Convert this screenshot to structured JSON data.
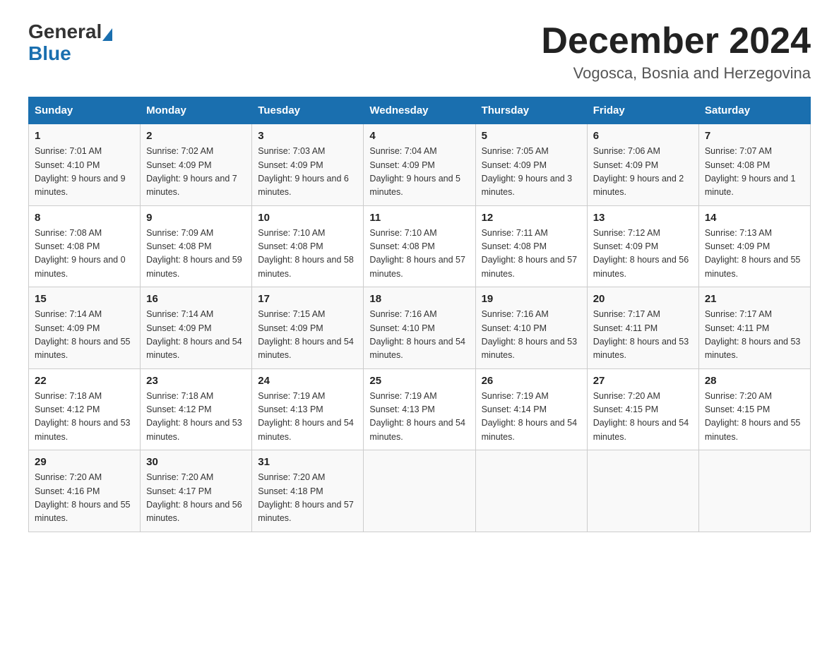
{
  "header": {
    "month_title": "December 2024",
    "location": "Vogosca, Bosnia and Herzegovina",
    "logo_general": "General",
    "logo_blue": "Blue"
  },
  "columns": [
    "Sunday",
    "Monday",
    "Tuesday",
    "Wednesday",
    "Thursday",
    "Friday",
    "Saturday"
  ],
  "weeks": [
    [
      {
        "day": "1",
        "sunrise": "7:01 AM",
        "sunset": "4:10 PM",
        "daylight": "9 hours and 9 minutes."
      },
      {
        "day": "2",
        "sunrise": "7:02 AM",
        "sunset": "4:09 PM",
        "daylight": "9 hours and 7 minutes."
      },
      {
        "day": "3",
        "sunrise": "7:03 AM",
        "sunset": "4:09 PM",
        "daylight": "9 hours and 6 minutes."
      },
      {
        "day": "4",
        "sunrise": "7:04 AM",
        "sunset": "4:09 PM",
        "daylight": "9 hours and 5 minutes."
      },
      {
        "day": "5",
        "sunrise": "7:05 AM",
        "sunset": "4:09 PM",
        "daylight": "9 hours and 3 minutes."
      },
      {
        "day": "6",
        "sunrise": "7:06 AM",
        "sunset": "4:09 PM",
        "daylight": "9 hours and 2 minutes."
      },
      {
        "day": "7",
        "sunrise": "7:07 AM",
        "sunset": "4:08 PM",
        "daylight": "9 hours and 1 minute."
      }
    ],
    [
      {
        "day": "8",
        "sunrise": "7:08 AM",
        "sunset": "4:08 PM",
        "daylight": "9 hours and 0 minutes."
      },
      {
        "day": "9",
        "sunrise": "7:09 AM",
        "sunset": "4:08 PM",
        "daylight": "8 hours and 59 minutes."
      },
      {
        "day": "10",
        "sunrise": "7:10 AM",
        "sunset": "4:08 PM",
        "daylight": "8 hours and 58 minutes."
      },
      {
        "day": "11",
        "sunrise": "7:10 AM",
        "sunset": "4:08 PM",
        "daylight": "8 hours and 57 minutes."
      },
      {
        "day": "12",
        "sunrise": "7:11 AM",
        "sunset": "4:08 PM",
        "daylight": "8 hours and 57 minutes."
      },
      {
        "day": "13",
        "sunrise": "7:12 AM",
        "sunset": "4:09 PM",
        "daylight": "8 hours and 56 minutes."
      },
      {
        "day": "14",
        "sunrise": "7:13 AM",
        "sunset": "4:09 PM",
        "daylight": "8 hours and 55 minutes."
      }
    ],
    [
      {
        "day": "15",
        "sunrise": "7:14 AM",
        "sunset": "4:09 PM",
        "daylight": "8 hours and 55 minutes."
      },
      {
        "day": "16",
        "sunrise": "7:14 AM",
        "sunset": "4:09 PM",
        "daylight": "8 hours and 54 minutes."
      },
      {
        "day": "17",
        "sunrise": "7:15 AM",
        "sunset": "4:09 PM",
        "daylight": "8 hours and 54 minutes."
      },
      {
        "day": "18",
        "sunrise": "7:16 AM",
        "sunset": "4:10 PM",
        "daylight": "8 hours and 54 minutes."
      },
      {
        "day": "19",
        "sunrise": "7:16 AM",
        "sunset": "4:10 PM",
        "daylight": "8 hours and 53 minutes."
      },
      {
        "day": "20",
        "sunrise": "7:17 AM",
        "sunset": "4:11 PM",
        "daylight": "8 hours and 53 minutes."
      },
      {
        "day": "21",
        "sunrise": "7:17 AM",
        "sunset": "4:11 PM",
        "daylight": "8 hours and 53 minutes."
      }
    ],
    [
      {
        "day": "22",
        "sunrise": "7:18 AM",
        "sunset": "4:12 PM",
        "daylight": "8 hours and 53 minutes."
      },
      {
        "day": "23",
        "sunrise": "7:18 AM",
        "sunset": "4:12 PM",
        "daylight": "8 hours and 53 minutes."
      },
      {
        "day": "24",
        "sunrise": "7:19 AM",
        "sunset": "4:13 PM",
        "daylight": "8 hours and 54 minutes."
      },
      {
        "day": "25",
        "sunrise": "7:19 AM",
        "sunset": "4:13 PM",
        "daylight": "8 hours and 54 minutes."
      },
      {
        "day": "26",
        "sunrise": "7:19 AM",
        "sunset": "4:14 PM",
        "daylight": "8 hours and 54 minutes."
      },
      {
        "day": "27",
        "sunrise": "7:20 AM",
        "sunset": "4:15 PM",
        "daylight": "8 hours and 54 minutes."
      },
      {
        "day": "28",
        "sunrise": "7:20 AM",
        "sunset": "4:15 PM",
        "daylight": "8 hours and 55 minutes."
      }
    ],
    [
      {
        "day": "29",
        "sunrise": "7:20 AM",
        "sunset": "4:16 PM",
        "daylight": "8 hours and 55 minutes."
      },
      {
        "day": "30",
        "sunrise": "7:20 AM",
        "sunset": "4:17 PM",
        "daylight": "8 hours and 56 minutes."
      },
      {
        "day": "31",
        "sunrise": "7:20 AM",
        "sunset": "4:18 PM",
        "daylight": "8 hours and 57 minutes."
      },
      null,
      null,
      null,
      null
    ]
  ],
  "labels": {
    "sunrise": "Sunrise:",
    "sunset": "Sunset:",
    "daylight": "Daylight:"
  }
}
